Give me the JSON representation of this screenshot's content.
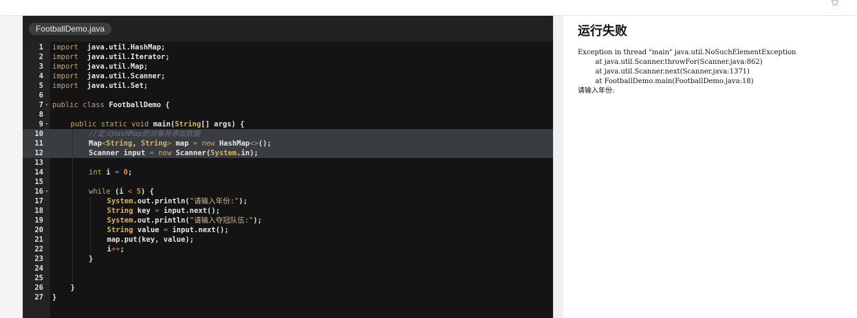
{
  "editor": {
    "file_tab": "FootballDemo.java",
    "lines": [
      {
        "n": "1",
        "fold": false,
        "hl": false,
        "indent": 0,
        "tokens": [
          [
            "kw",
            "import"
          ],
          [
            "",
            "  java.util.HashMap;"
          ]
        ]
      },
      {
        "n": "2",
        "fold": false,
        "hl": false,
        "indent": 0,
        "tokens": [
          [
            "kw",
            "import"
          ],
          [
            "",
            "  java.util.Iterator;"
          ]
        ]
      },
      {
        "n": "3",
        "fold": false,
        "hl": false,
        "indent": 0,
        "tokens": [
          [
            "kw",
            "import"
          ],
          [
            "",
            "  java.util.Map;"
          ]
        ]
      },
      {
        "n": "4",
        "fold": false,
        "hl": false,
        "indent": 0,
        "tokens": [
          [
            "kw",
            "import"
          ],
          [
            "",
            "  java.util.Scanner;"
          ]
        ]
      },
      {
        "n": "5",
        "fold": false,
        "hl": false,
        "indent": 0,
        "tokens": [
          [
            "kw",
            "import"
          ],
          [
            "",
            "  java.util.Set;"
          ]
        ]
      },
      {
        "n": "6",
        "fold": false,
        "hl": false,
        "indent": 0,
        "tokens": []
      },
      {
        "n": "7",
        "fold": true,
        "hl": false,
        "indent": 0,
        "tokens": [
          [
            "kw",
            "public class "
          ],
          [
            "",
            "FootballDemo {"
          ]
        ]
      },
      {
        "n": "8",
        "fold": false,
        "hl": false,
        "indent": 0,
        "tokens": []
      },
      {
        "n": "9",
        "fold": true,
        "hl": false,
        "indent": 1,
        "tokens": [
          [
            "kw",
            "public static void "
          ],
          [
            "",
            "main("
          ],
          [
            "ty",
            "String"
          ],
          [
            "",
            "[] args) {"
          ]
        ]
      },
      {
        "n": "10",
        "fold": false,
        "hl": true,
        "indent": 2,
        "tokens": [
          [
            "cm",
            "//定义HashMap的对象并添加数据"
          ]
        ]
      },
      {
        "n": "11",
        "fold": false,
        "hl": true,
        "indent": 2,
        "tokens": [
          [
            "",
            "Map"
          ],
          [
            "op",
            "<"
          ],
          [
            "ty",
            "String"
          ],
          [
            "",
            ", "
          ],
          [
            "ty",
            "String"
          ],
          [
            "op",
            "> "
          ],
          [
            "",
            "map "
          ],
          [
            "op",
            "= "
          ],
          [
            "kw",
            "new "
          ],
          [
            "",
            "HashMap"
          ],
          [
            "op",
            "<>"
          ],
          [
            "",
            "();"
          ]
        ]
      },
      {
        "n": "12",
        "fold": false,
        "hl": true,
        "indent": 2,
        "tokens": [
          [
            "",
            "Scanner input "
          ],
          [
            "op",
            "= "
          ],
          [
            "kw",
            "new "
          ],
          [
            "",
            "Scanner("
          ],
          [
            "ty",
            "System"
          ],
          [
            "",
            ".in);"
          ]
        ]
      },
      {
        "n": "13",
        "fold": false,
        "hl": false,
        "indent": 0,
        "tokens": []
      },
      {
        "n": "14",
        "fold": false,
        "hl": false,
        "indent": 2,
        "tokens": [
          [
            "kw",
            "int "
          ],
          [
            "",
            "i "
          ],
          [
            "op",
            "= "
          ],
          [
            "nm",
            "0"
          ],
          [
            "",
            ";"
          ]
        ]
      },
      {
        "n": "15",
        "fold": false,
        "hl": false,
        "indent": 0,
        "tokens": []
      },
      {
        "n": "16",
        "fold": true,
        "hl": false,
        "indent": 2,
        "tokens": [
          [
            "kw",
            "while "
          ],
          [
            "",
            "(i "
          ],
          [
            "op",
            "< "
          ],
          [
            "nm",
            "5"
          ],
          [
            "",
            ") {"
          ]
        ]
      },
      {
        "n": "17",
        "fold": false,
        "hl": false,
        "indent": 3,
        "tokens": [
          [
            "ty",
            "System"
          ],
          [
            "",
            ".out.println("
          ],
          [
            "st",
            "\"请输入年份:\""
          ],
          [
            "",
            ");"
          ]
        ]
      },
      {
        "n": "18",
        "fold": false,
        "hl": false,
        "indent": 3,
        "tokens": [
          [
            "ty",
            "String "
          ],
          [
            "",
            "key "
          ],
          [
            "op",
            "= "
          ],
          [
            "",
            "input.next();"
          ]
        ]
      },
      {
        "n": "19",
        "fold": false,
        "hl": false,
        "indent": 3,
        "tokens": [
          [
            "ty",
            "System"
          ],
          [
            "",
            ".out.println("
          ],
          [
            "st",
            "\"请输入夺冠队伍:\""
          ],
          [
            "",
            ");"
          ]
        ]
      },
      {
        "n": "20",
        "fold": false,
        "hl": false,
        "indent": 3,
        "tokens": [
          [
            "ty",
            "String "
          ],
          [
            "",
            "value "
          ],
          [
            "op",
            "= "
          ],
          [
            "",
            "input.next();"
          ]
        ]
      },
      {
        "n": "21",
        "fold": false,
        "hl": false,
        "indent": 3,
        "tokens": [
          [
            "",
            "map.put(key, value);"
          ]
        ]
      },
      {
        "n": "22",
        "fold": false,
        "hl": false,
        "indent": 3,
        "tokens": [
          [
            "",
            "i"
          ],
          [
            "op",
            "++"
          ],
          [
            "",
            ";"
          ]
        ]
      },
      {
        "n": "23",
        "fold": false,
        "hl": false,
        "indent": 2,
        "tokens": [
          [
            "",
            "}"
          ]
        ]
      },
      {
        "n": "24",
        "fold": false,
        "hl": false,
        "indent": 0,
        "tokens": []
      },
      {
        "n": "25",
        "fold": false,
        "hl": false,
        "indent": 0,
        "tokens": []
      },
      {
        "n": "26",
        "fold": false,
        "hl": false,
        "indent": 1,
        "tokens": [
          [
            "",
            "}"
          ]
        ]
      },
      {
        "n": "27",
        "fold": false,
        "hl": false,
        "indent": 0,
        "tokens": [
          [
            "",
            "}"
          ]
        ]
      }
    ]
  },
  "output": {
    "title": "运行失败",
    "text": "Exception in thread \"main\" java.util.NoSuchElementException\n\tat java.util.Scanner.throwFor(Scanner.java:862)\n\tat java.util.Scanner.next(Scanner.java:1371)\n\tat FootballDemo.main(FootballDemo.java:18)\n请输入年份:"
  },
  "icons": {
    "cart": "shopping-cart-icon"
  },
  "colors": {
    "editor_bg": "#141414",
    "gutter_bg": "#232323",
    "keyword": "#c8a46e",
    "comment": "#6b7280",
    "highlight": "#3a3d40"
  }
}
